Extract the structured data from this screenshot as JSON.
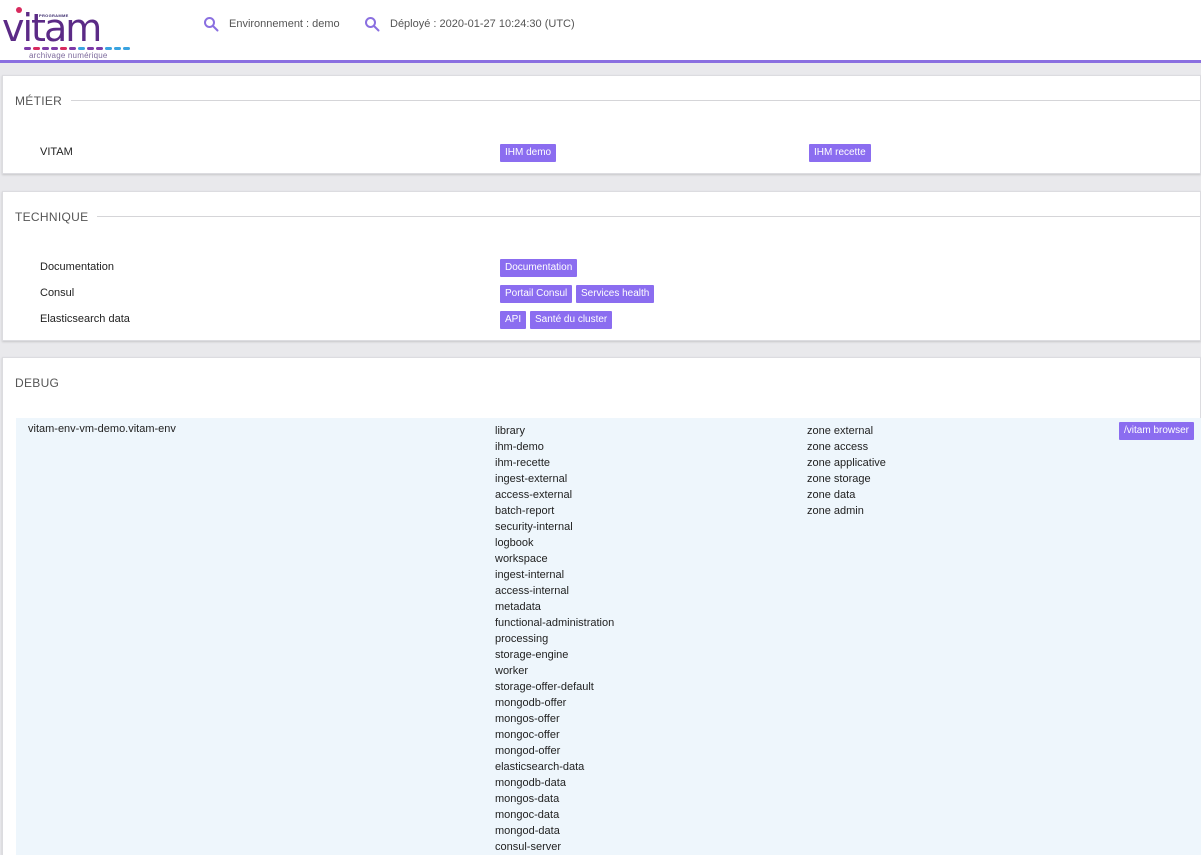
{
  "header": {
    "logo_program": "PROGRAMME",
    "logo_word": "vitam",
    "logo_tagline": "archivage numérique",
    "environment": "Environnement : demo",
    "deployed": "Déployé : 2020-01-27 10:24:30 (UTC)"
  },
  "metier": {
    "title": "MÉTIER",
    "rows": [
      {
        "label": "VITAM",
        "link1": "IHM demo",
        "link2": "IHM recette"
      }
    ]
  },
  "technique": {
    "title": "TECHNIQUE",
    "rows": [
      {
        "label": "Documentation",
        "links": [
          "Documentation"
        ]
      },
      {
        "label": "Consul",
        "links": [
          "Portail Consul",
          "Services health"
        ]
      },
      {
        "label": "Elasticsearch data",
        "links": [
          "API",
          "Santé du cluster"
        ]
      }
    ]
  },
  "debug": {
    "title": "DEBUG",
    "host": "vitam-env-vm-demo.vitam-env",
    "browser_button": "/vitam browser",
    "services": [
      "library",
      "ihm-demo",
      "ihm-recette",
      "ingest-external",
      "access-external",
      "batch-report",
      "security-internal",
      "logbook",
      "workspace",
      "ingest-internal",
      "access-internal",
      "metadata",
      "functional-administration",
      "processing",
      "storage-engine",
      "worker",
      "storage-offer-default",
      "mongodb-offer",
      "mongos-offer",
      "mongoc-offer",
      "mongod-offer",
      "elasticsearch-data",
      "mongodb-data",
      "mongos-data",
      "mongoc-data",
      "mongod-data",
      "consul-server"
    ],
    "zones": [
      "zone external",
      "zone access",
      "zone applicative",
      "zone storage",
      "zone data",
      "zone admin"
    ]
  },
  "colors": {
    "accent": "#8b6df0",
    "header_border": "#8a6fe0",
    "debug_bg": "#eef6fc"
  }
}
